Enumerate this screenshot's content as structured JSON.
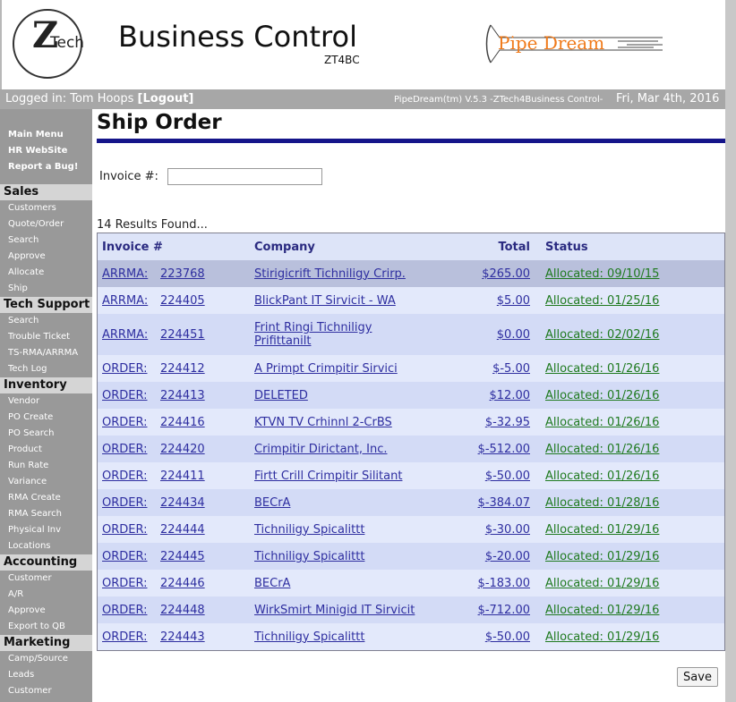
{
  "header": {
    "logo_z": "Z",
    "logo_tech": "Tech",
    "title": "Business Control",
    "code": "ZT4BC",
    "pipedream_logo_text": "Pipe Dream"
  },
  "topbar": {
    "logged_in_label": "Logged in: Tom Hoops",
    "logout_label": "[Logout]",
    "version": "PipeDream(tm) V.5.3 -ZTech4Business Control-",
    "date": "Fri, Mar 4th, 2016"
  },
  "sidebar": {
    "quick_links": [
      "Main Menu",
      "HR WebSite",
      "Report a Bug!"
    ],
    "sections": [
      {
        "title": "Sales",
        "items": [
          "Customers",
          "Quote/Order",
          "Search",
          "Approve",
          "Allocate",
          "Ship"
        ]
      },
      {
        "title": "Tech Support",
        "items": [
          "Search",
          "Trouble Ticket",
          "TS-RMA/ARRMA",
          "Tech Log"
        ]
      },
      {
        "title": "Inventory",
        "items": [
          "Vendor",
          "PO Create",
          "PO Search",
          "Product",
          "Run Rate",
          "Variance",
          "RMA Create",
          "RMA Search",
          "Physical Inv",
          "Locations"
        ]
      },
      {
        "title": "Accounting",
        "items": [
          "Customer",
          "A/R",
          "Approve",
          "Export to QB"
        ]
      },
      {
        "title": "Marketing",
        "items": [
          "Camp/Source",
          "Leads",
          "Customer"
        ]
      }
    ]
  },
  "main": {
    "page_title": "Ship Order",
    "invoice_label": "Invoice #:",
    "invoice_value": "",
    "results_text": "14 Results Found...",
    "columns": [
      "Invoice #",
      "Company",
      "Total",
      "Status"
    ],
    "rows": [
      {
        "type": "ARRMA:",
        "num": "223768",
        "company": "Stirigicrift Tichniligy Crirp.",
        "total": "$265.00",
        "status": "Allocated: 09/10/15"
      },
      {
        "type": "ARRMA:",
        "num": "224405",
        "company": "BlickPant IT Sirvicit - WA",
        "total": "$5.00",
        "status": "Allocated: 01/25/16"
      },
      {
        "type": "ARRMA:",
        "num": "224451",
        "company": "Frint Ringi Tichniligy Prifittanilt",
        "total": "$0.00",
        "status": "Allocated: 02/02/16"
      },
      {
        "type": "ORDER:",
        "num": "224412",
        "company": "A Primpt Crimpitir Sirvici",
        "total": "$-5.00",
        "status": "Allocated: 01/26/16"
      },
      {
        "type": "ORDER:",
        "num": "224413",
        "company": "DELETED",
        "total": "$12.00",
        "status": "Allocated: 01/26/16"
      },
      {
        "type": "ORDER:",
        "num": "224416",
        "company": "KTVN TV Crhinnl 2-CrBS",
        "total": "$-32.95",
        "status": "Allocated: 01/26/16"
      },
      {
        "type": "ORDER:",
        "num": "224420",
        "company": "Crimpitir Dirictant, Inc.",
        "total": "$-512.00",
        "status": "Allocated: 01/26/16"
      },
      {
        "type": "ORDER:",
        "num": "224411",
        "company": "Firtt Crill Crimpitir Silitant",
        "total": "$-50.00",
        "status": "Allocated: 01/26/16"
      },
      {
        "type": "ORDER:",
        "num": "224434",
        "company": "BECrA",
        "total": "$-384.07",
        "status": "Allocated: 01/28/16"
      },
      {
        "type": "ORDER:",
        "num": "224444",
        "company": "Tichniligy Spicalittt",
        "total": "$-30.00",
        "status": "Allocated: 01/29/16"
      },
      {
        "type": "ORDER:",
        "num": "224445",
        "company": "Tichniligy Spicalittt",
        "total": "$-20.00",
        "status": "Allocated: 01/29/16"
      },
      {
        "type": "ORDER:",
        "num": "224446",
        "company": "BECrA",
        "total": "$-183.00",
        "status": "Allocated: 01/29/16"
      },
      {
        "type": "ORDER:",
        "num": "224448",
        "company": "WirkSmirt Minigid IT Sirvicit",
        "total": "$-712.00",
        "status": "Allocated: 01/29/16"
      },
      {
        "type": "ORDER:",
        "num": "224443",
        "company": "Tichniligy Spicalittt",
        "total": "$-50.00",
        "status": "Allocated: 01/29/16"
      }
    ],
    "save_label": "Save"
  },
  "colors": {
    "link": "#2e2ea0",
    "status_link": "#1f7a1f",
    "title_rule": "#15158a",
    "sidebar_bg": "#999999",
    "topbar_bg": "#a7a7a7"
  }
}
